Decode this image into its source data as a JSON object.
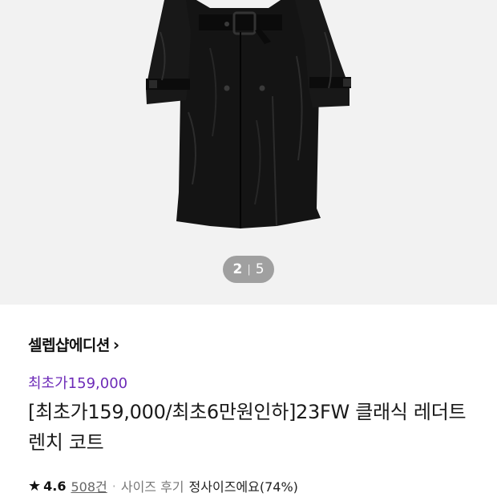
{
  "gallery": {
    "current_page": "2",
    "separator": "|",
    "total_pages": "5",
    "colors": {
      "background": "#f2f2f2",
      "coat": "#121212",
      "pager_bg": "#808080"
    }
  },
  "product": {
    "brand": "셀렙샵에디션",
    "brand_chevron": "›",
    "promo_price": "최초가159,000",
    "title": "[최초가159,000/최초6만원인하]23FW 클래식 레더트렌치 코트",
    "rating": {
      "star_icon": "★",
      "score": "4.6",
      "review_count": "508건",
      "separator": "·",
      "size_review_label": "사이즈 후기",
      "size_review_value": "정사이즈에요(74%)"
    },
    "colors": {
      "promo": "#6d2bb8"
    }
  }
}
